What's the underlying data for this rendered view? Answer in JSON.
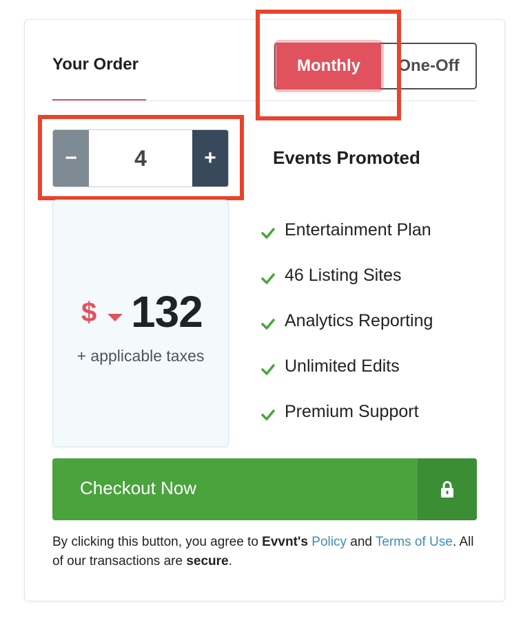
{
  "header": {
    "title": "Your Order",
    "billing_options": [
      "Monthly",
      "One-Off"
    ],
    "selected_option": "Monthly"
  },
  "stepper": {
    "minus_label": "−",
    "plus_label": "+",
    "value": "4",
    "label": "Events Promoted"
  },
  "price": {
    "currency": "$",
    "amount": "132",
    "note": "+ applicable taxes"
  },
  "features": [
    "Entertainment Plan",
    "46 Listing Sites",
    "Analytics Reporting",
    "Unlimited Edits",
    "Premium Support"
  ],
  "checkout": {
    "label": "Checkout Now",
    "icon": "lock-icon"
  },
  "legal": {
    "prefix": "By clicking this button, you agree to ",
    "brand": "Evvnt's",
    "policy_link": "Policy",
    "and": " and ",
    "terms_link": "Terms of Use",
    "middle": ". All of our transactions are ",
    "secure": "secure",
    "end": "."
  },
  "colors": {
    "accent": "#e0525d",
    "checkout_green": "#4aa33d",
    "checkout_lock_green": "#3b8e33",
    "stepper_minus": "#7d8a93",
    "stepper_plus": "#37495a",
    "check_green": "#4aa33d",
    "link": "#3e8db6",
    "highlight_box": "#e8442d"
  }
}
